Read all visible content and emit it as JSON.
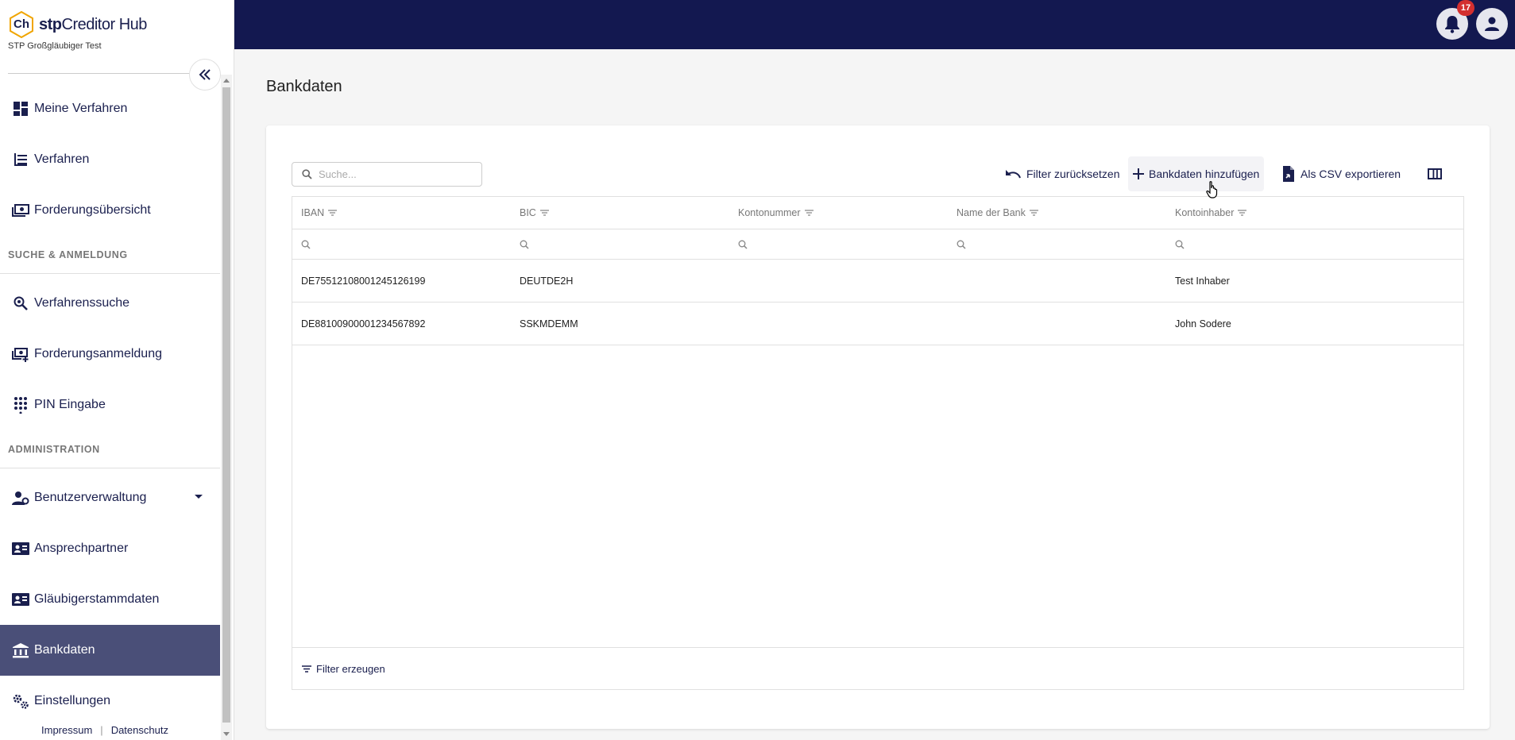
{
  "brand": {
    "logo_text": "Ch",
    "name_bold": "stp",
    "name_rest": "Creditor Hub",
    "subtitle": "STP Großgläubiger Test"
  },
  "sidebar": {
    "items_top": [
      {
        "label": "Meine Verfahren",
        "icon": "dashboard-icon"
      },
      {
        "label": "Verfahren",
        "icon": "list-icon"
      },
      {
        "label": "Forderungsübersicht",
        "icon": "money-icon"
      }
    ],
    "section_search": "SUCHE & ANMELDUNG",
    "items_search": [
      {
        "label": "Verfahrenssuche",
        "icon": "search-magnify-icon"
      },
      {
        "label": "Forderungsanmeldung",
        "icon": "money-add-icon"
      },
      {
        "label": "PIN Eingabe",
        "icon": "dialpad-icon"
      }
    ],
    "section_admin": "ADMINISTRATION",
    "items_admin": [
      {
        "label": "Benutzerverwaltung",
        "icon": "user-cog-icon"
      },
      {
        "label": "Ansprechpartner",
        "icon": "contact-card-icon"
      },
      {
        "label": "Gläubigerstammdaten",
        "icon": "contact-card-icon"
      },
      {
        "label": "Bankdaten",
        "icon": "bank-icon"
      },
      {
        "label": "Einstellungen",
        "icon": "settings-icon"
      }
    ],
    "active_item": "Bankdaten",
    "footer": {
      "impressum": "Impressum",
      "separator": "|",
      "datenschutz": "Datenschutz"
    }
  },
  "topbar": {
    "notification_count": "17"
  },
  "page": {
    "title": "Bankdaten"
  },
  "toolbar": {
    "search_placeholder": "Suche...",
    "reset_filter": "Filter zurücksetzen",
    "add_bankdata": "Bankdaten hinzufügen",
    "export_csv": "Als CSV exportieren"
  },
  "table": {
    "columns": [
      "IBAN",
      "BIC",
      "Kontonummer",
      "Name der Bank",
      "Kontoinhaber"
    ],
    "rows": [
      [
        "DE75512108001245126199",
        "DEUTDE2H",
        "",
        "",
        "Test Inhaber"
      ],
      [
        "DE88100900001234567892",
        "SSKMDEMM",
        "",
        "",
        "John Sodere"
      ]
    ],
    "footer_filter": "Filter erzeugen"
  },
  "colors": {
    "primary": "#131850",
    "active_nav": "#4a4f78",
    "badge": "#d32f2f",
    "logo_accent": "#f0a500"
  }
}
